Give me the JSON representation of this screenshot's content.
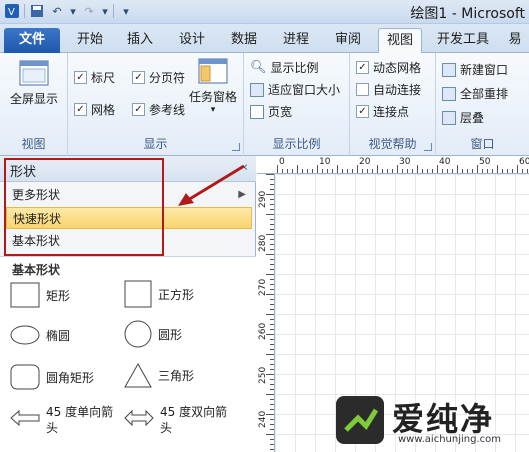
{
  "window": {
    "title": "绘图1 - Microsoft"
  },
  "tabs": [
    "文件",
    "开始",
    "插入",
    "设计",
    "数据",
    "进程",
    "审阅",
    "视图",
    "开发工具",
    "易"
  ],
  "active_tab": "视图",
  "ribbon": {
    "view_group": {
      "fullscreen": "全屏显示",
      "label": "视图"
    },
    "show_group": {
      "ruler": "标尺",
      "page_breaks": "分页符",
      "grid": "网格",
      "guides": "参考线",
      "task_panes": "任务窗格",
      "label": "显示",
      "checked": {
        "ruler": true,
        "page_breaks": true,
        "grid": true,
        "guides": true
      }
    },
    "zoom_group": {
      "zoom": "显示比例",
      "fit_window": "适应窗口大小",
      "page_width": "页宽",
      "label": "显示比例"
    },
    "visual_aids_group": {
      "dynamic_grid": "动态网格",
      "autoconnect": "自动连接",
      "connection_points": "连接点",
      "label": "视觉帮助",
      "checked": {
        "dynamic_grid": true,
        "autoconnect": false,
        "connection_points": true
      }
    },
    "window_group": {
      "new_window": "新建窗口",
      "arrange_all": "全部重排",
      "cascade": "层叠",
      "label": "窗口"
    }
  },
  "shapes_pane": {
    "title": "形状",
    "items": [
      "更多形状",
      "快速形状",
      "基本形状"
    ],
    "selected": "快速形状",
    "stencil_title": "基本形状",
    "shapes": [
      {
        "label": "矩形",
        "icon": "rectangle-icon"
      },
      {
        "label": "正方形",
        "icon": "square-icon"
      },
      {
        "label": "椭圆",
        "icon": "ellipse-icon"
      },
      {
        "label": "圆形",
        "icon": "circle-icon"
      },
      {
        "label": "圆角矩形",
        "icon": "rounded-rectangle-icon"
      },
      {
        "label": "三角形",
        "icon": "triangle-icon"
      },
      {
        "label": "45 度单向箭头",
        "icon": "single-arrow-icon"
      },
      {
        "label": "45 度双向箭头",
        "icon": "double-arrow-icon"
      }
    ]
  },
  "rulers": {
    "top": [
      "0",
      "10",
      "20",
      "30",
      "40",
      "50",
      "60"
    ],
    "left": [
      "290",
      "280",
      "270",
      "260",
      "250",
      "240"
    ]
  },
  "watermark": {
    "text": "爱纯净",
    "url": "www.aichunjing.com"
  },
  "colors": {
    "annotation": "#b11a1a",
    "selection": "#f9d56d",
    "file_tab": "#1d58ab"
  }
}
